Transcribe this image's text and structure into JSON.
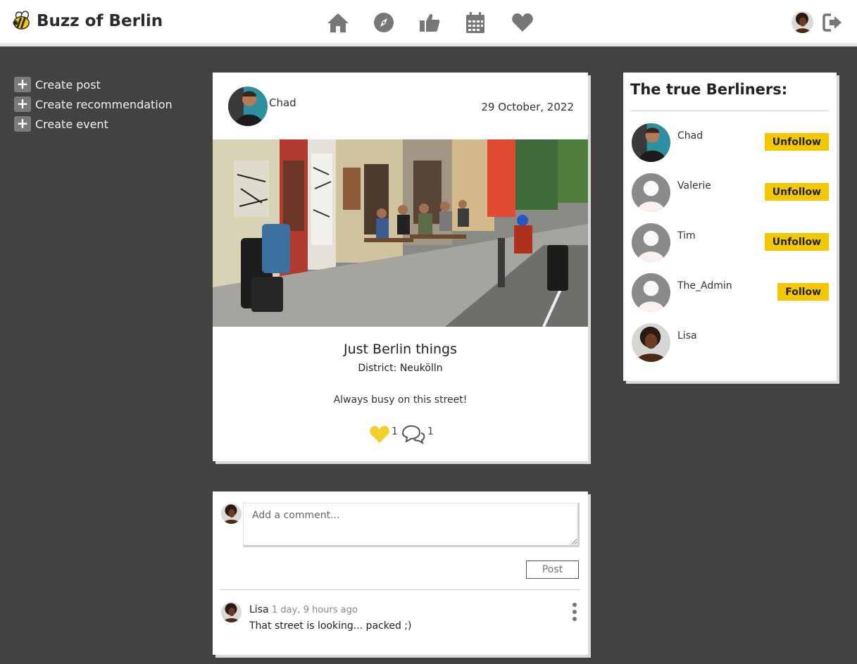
{
  "app": {
    "title": "Buzz of Berlin"
  },
  "nav": {
    "icons": [
      "home-icon",
      "compass-icon",
      "thumbs-up-icon",
      "calendar-icon",
      "heart-icon"
    ],
    "logout_icon": "sign-out-icon",
    "accent": "#f4c800"
  },
  "sidebar": {
    "links": [
      {
        "label": "Create post"
      },
      {
        "label": "Create recommendation"
      },
      {
        "label": "Create event"
      }
    ]
  },
  "post": {
    "author": "Chad",
    "date": "29 October, 2022",
    "title": "Just Berlin things",
    "district": "District: Neukölln",
    "content": "Always busy on this street!",
    "likes": "1",
    "comments": "1"
  },
  "comment_form": {
    "placeholder": "Add a comment...",
    "submit_label": "Post"
  },
  "comments": [
    {
      "author": "Lisa",
      "time": "1 day, 9 hours ago",
      "text": "That street is looking... packed ;)"
    }
  ],
  "users": {
    "title": "The true Berliners:",
    "list": [
      {
        "name": "Chad",
        "button": "Unfollow"
      },
      {
        "name": "Valerie",
        "button": "Unfollow"
      },
      {
        "name": "Tim",
        "button": "Unfollow"
      },
      {
        "name": "The_Admin",
        "button": "Follow"
      },
      {
        "name": "Lisa",
        "button": ""
      }
    ]
  }
}
